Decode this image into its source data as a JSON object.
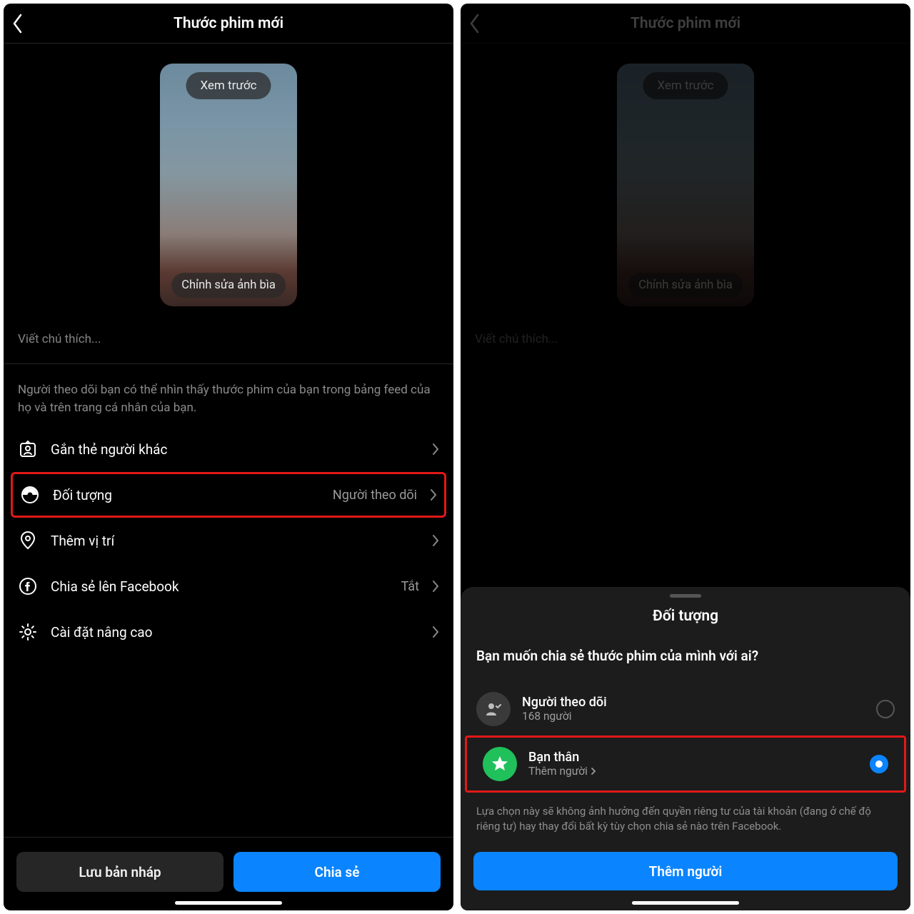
{
  "left": {
    "header": {
      "title": "Thước phim mới"
    },
    "preview": {
      "top_pill": "Xem trước",
      "bot_pill": "Chỉnh sửa ảnh bìa"
    },
    "caption_placeholder": "Viết chú thích...",
    "info_text": "Người theo dõi bạn có thể nhìn thấy thước phim của bạn trong bảng feed của họ và trên trang cá nhân của bạn.",
    "rows": {
      "tag": {
        "label": "Gắn thẻ người khác"
      },
      "audience": {
        "label": "Đối tượng",
        "value": "Người theo dõi"
      },
      "location": {
        "label": "Thêm vị trí"
      },
      "facebook": {
        "label": "Chia sẻ lên Facebook",
        "value": "Tắt"
      },
      "advanced": {
        "label": "Cài đặt nâng cao"
      }
    },
    "buttons": {
      "draft": "Lưu bản nháp",
      "share": "Chia sẻ"
    }
  },
  "right": {
    "header": {
      "title": "Thước phim mới"
    },
    "preview": {
      "top_pill": "Xem trước",
      "bot_pill": "Chỉnh sửa ảnh bìa"
    },
    "caption_placeholder": "Viết chú thích...",
    "sheet": {
      "title": "Đối tượng",
      "question": "Bạn muốn chia sẻ thước phim của mình với ai?",
      "opt_followers": {
        "title": "Người theo dõi",
        "sub": "168 người"
      },
      "opt_close": {
        "title": "Bạn thân",
        "sub": "Thêm người"
      },
      "note": "Lựa chọn này sẽ không ảnh hưởng đến quyền riêng tư của tài khoản (đang ở chế độ riêng tư) hay thay đổi bất kỳ tùy chọn chia sẻ nào trên Facebook.",
      "button": "Thêm người"
    }
  }
}
